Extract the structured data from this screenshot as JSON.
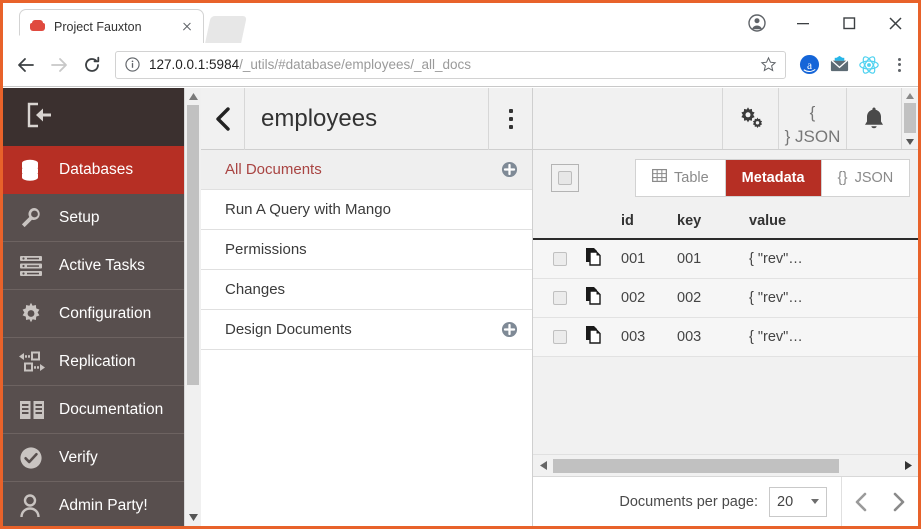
{
  "browser": {
    "tab": {
      "title": "Project Fauxton",
      "favicon": "couch-icon",
      "close": "close-icon"
    },
    "window_controls": {
      "profile": "account-icon",
      "minimize": "minimize-icon",
      "maximize": "maximize-icon",
      "close": "close-icon"
    },
    "toolbar": {
      "back": "back-arrow-icon",
      "forward": "forward-arrow-icon",
      "reload": "reload-icon",
      "site_info": "info-icon",
      "url_host": "127.0.0.1:5984",
      "url_path": "/_utils/#database/employees/_all_docs",
      "bookmark": "star-icon",
      "extensions": [
        "amazon-extension-icon",
        "mailbox-extension-icon",
        "react-devtools-icon"
      ],
      "menu": "kebab-menu-icon"
    }
  },
  "sidebar": {
    "logo_icon": "logout-arrow-icon",
    "items": [
      {
        "label": "Databases",
        "icon": "database-icon",
        "active": true
      },
      {
        "label": "Setup",
        "icon": "wrench-icon",
        "active": false
      },
      {
        "label": "Active Tasks",
        "icon": "tasks-icon",
        "active": false
      },
      {
        "label": "Configuration",
        "icon": "gear-icon",
        "active": false
      },
      {
        "label": "Replication",
        "icon": "replication-icon",
        "active": false
      },
      {
        "label": "Documentation",
        "icon": "book-icon",
        "active": false
      },
      {
        "label": "Verify",
        "icon": "check-circle-icon",
        "active": false
      },
      {
        "label": "Admin Party!",
        "icon": "user-icon",
        "active": false
      }
    ]
  },
  "middle_panel": {
    "back_icon": "chevron-left-icon",
    "title": "employees",
    "kebab_icon": "kebab-menu-icon",
    "items": [
      {
        "label": "All Documents",
        "selected": true,
        "add": true
      },
      {
        "label": "Run A Query with Mango",
        "selected": false,
        "add": false
      },
      {
        "label": "Permissions",
        "selected": false,
        "add": false
      },
      {
        "label": "Changes",
        "selected": false,
        "add": false
      },
      {
        "label": "Design Documents",
        "selected": false,
        "add": true
      }
    ]
  },
  "right_panel": {
    "header_buttons": [
      {
        "icon": "gears-icon",
        "label": ""
      },
      {
        "icon": "json-braces-icon",
        "label_line1": "{",
        "label_line2": "} JSON"
      },
      {
        "icon": "bell-icon",
        "label": ""
      }
    ],
    "select_all": "select-all-checkbox",
    "view_tabs": [
      {
        "label": "Table",
        "icon": "table-grid-icon",
        "active": false
      },
      {
        "label": "Metadata",
        "icon": "",
        "active": true
      },
      {
        "label": "JSON",
        "icon": "braces-icon",
        "active": false
      }
    ],
    "table": {
      "columns": [
        "",
        "",
        "id",
        "key",
        "value"
      ],
      "headers": {
        "id": "id",
        "key": "key",
        "value": "value"
      },
      "rows": [
        {
          "doc_icon": "document-copy-icon",
          "id": "001",
          "key": "001",
          "value": "{ \"rev\"…"
        },
        {
          "doc_icon": "document-copy-icon",
          "id": "002",
          "key": "002",
          "value": "{ \"rev\"…"
        },
        {
          "doc_icon": "document-copy-icon",
          "id": "003",
          "key": "003",
          "value": "{ \"rev\"…"
        }
      ]
    },
    "footer": {
      "per_page_label": "Documents per page:",
      "per_page_value": "20",
      "prev_icon": "chevron-left-icon",
      "next_icon": "chevron-right-icon"
    }
  },
  "colors": {
    "accent_red": "#b62f24",
    "sidebar_bg": "#584f4e",
    "sidebar_logo_bg": "#3b302f",
    "window_border": "#e8622a"
  }
}
